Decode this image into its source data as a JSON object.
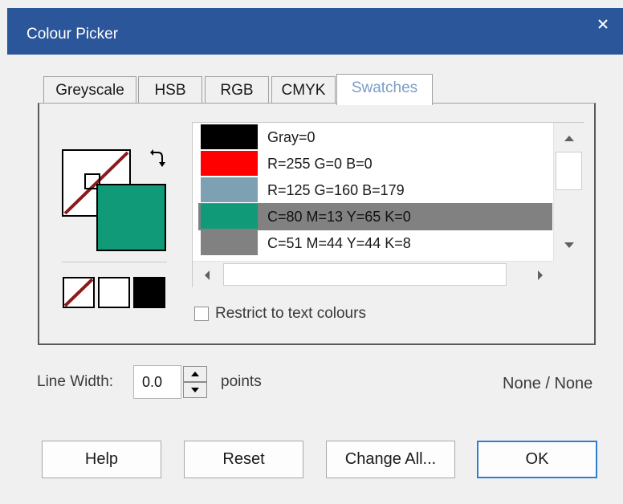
{
  "window": {
    "title": "Colour Picker",
    "close_icon": "close-icon"
  },
  "tabs": [
    {
      "label": "Greyscale"
    },
    {
      "label": "HSB"
    },
    {
      "label": "RGB"
    },
    {
      "label": "CMYK"
    },
    {
      "label": "Swatches",
      "active": true
    }
  ],
  "colors": {
    "titlebar": "#2b579a",
    "current_fill": "#119a77",
    "active_tab_text": "#7a9dc8",
    "selected_row": "#818181",
    "none_slash": "#8b1a1a",
    "ok_border": "#2f7fd1"
  },
  "swatches": [
    {
      "label": "Gray=0",
      "color": "#000000"
    },
    {
      "label": "R=255 G=0 B=0",
      "color": "#ff0000"
    },
    {
      "label": "R=125 G=160 B=179",
      "color": "#7da0b3"
    },
    {
      "label": "C=80 M=13 Y=65 K=0",
      "color": "#119a77",
      "selected": true
    },
    {
      "label": "C=51 M=44 Y=44 K=8",
      "color": "#818181"
    }
  ],
  "restrict": {
    "label": "Restrict to text colours",
    "checked": false
  },
  "line_width": {
    "label": "Line Width:",
    "value": "0.0",
    "unit": "points"
  },
  "status": {
    "text": "None / None"
  },
  "buttons": {
    "help": "Help",
    "reset": "Reset",
    "change_all": "Change All...",
    "ok": "OK"
  }
}
